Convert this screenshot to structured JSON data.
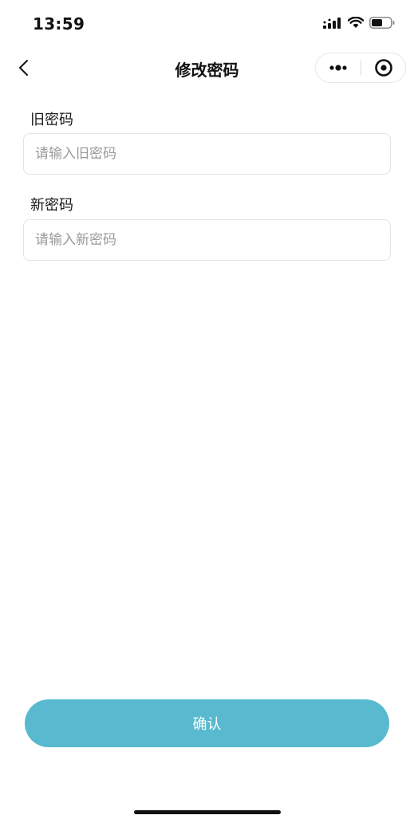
{
  "status_bar": {
    "time": "13:59",
    "icons": [
      "signal-icon",
      "wifi-icon",
      "battery-icon"
    ]
  },
  "nav": {
    "title": "修改密码",
    "back_icon": "chevron-left-icon",
    "capsule": {
      "more_icon": "more-dots-icon",
      "close_icon": "target-circle-icon"
    }
  },
  "form": {
    "old_password": {
      "label": "旧密码",
      "placeholder": "请输入旧密码",
      "value": ""
    },
    "new_password": {
      "label": "新密码",
      "placeholder": "请输入新密码",
      "value": ""
    }
  },
  "confirm_button": {
    "label": "确认",
    "color": "#58b9cf"
  }
}
